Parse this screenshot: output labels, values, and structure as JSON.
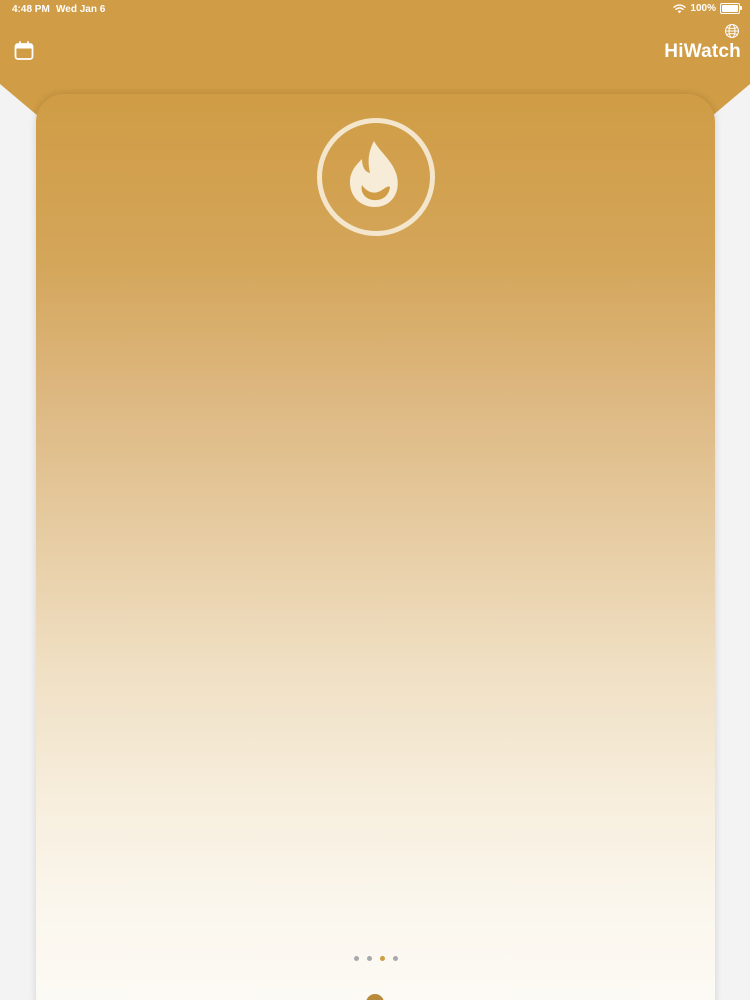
{
  "status_bar": {
    "time": "4:48 PM",
    "date": "Wed Jan 6",
    "battery_text": "100%",
    "battery_level": 1.0
  },
  "header": {
    "title": "HiWatch",
    "calendar_icon": "calendar-icon",
    "globe_icon": "globe-icon"
  },
  "card": {
    "icon": "flame-icon"
  },
  "pager": {
    "count": 4,
    "active_index": 2
  },
  "colors": {
    "accent": "#d09c45",
    "accent_light": "#f3e6cc",
    "background": "#f3f3f4",
    "dot_inactive": "#a9a9ad",
    "white": "#ffffff"
  }
}
